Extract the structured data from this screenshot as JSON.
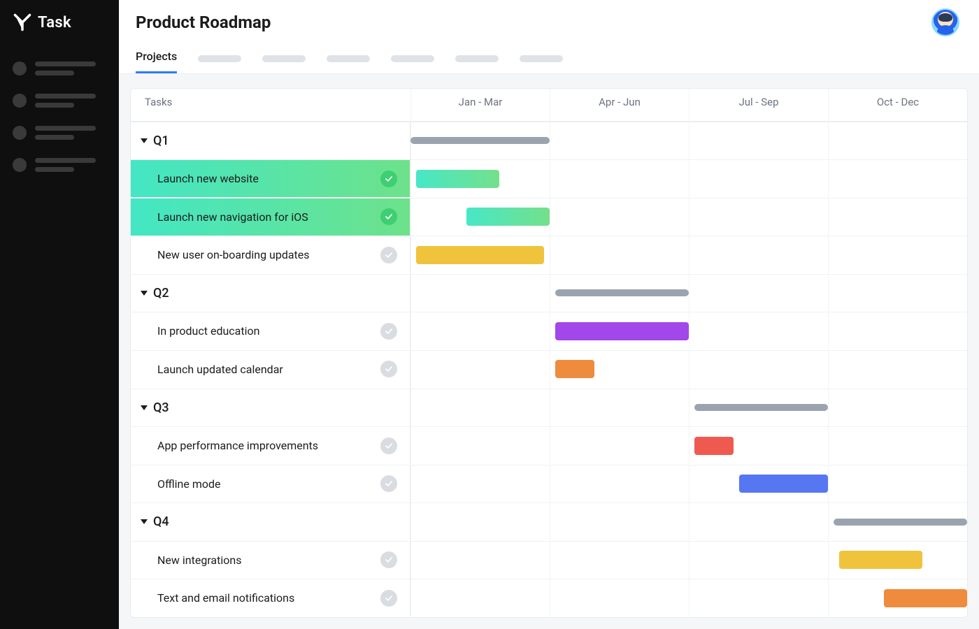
{
  "brand": {
    "name": "Task"
  },
  "header": {
    "title": "Product Roadmap"
  },
  "tabs": {
    "active": "Projects",
    "placeholder_count": 6
  },
  "chart_data": {
    "type": "gantt",
    "columns_header": "Tasks",
    "periods": [
      "Jan - Mar",
      "Apr - Jun",
      "Jul - Sep",
      "Oct - Dec"
    ],
    "groups": [
      {
        "name": "Q1",
        "summary": {
          "start": 0.0,
          "end": 0.25
        },
        "tasks": [
          {
            "name": "Launch new website",
            "done": true,
            "selected": true,
            "color": "green",
            "start": 0.01,
            "end": 0.16
          },
          {
            "name": "Launch new navigation for iOS",
            "done": true,
            "selected": true,
            "color": "green",
            "start": 0.1,
            "end": 0.25
          },
          {
            "name": "New user on-boarding updates",
            "done": false,
            "color": "yellow",
            "start": 0.01,
            "end": 0.24
          }
        ]
      },
      {
        "name": "Q2",
        "summary": {
          "start": 0.26,
          "end": 0.5
        },
        "tasks": [
          {
            "name": "In product education",
            "done": false,
            "color": "purple",
            "start": 0.26,
            "end": 0.5
          },
          {
            "name": "Launch updated calendar",
            "done": false,
            "color": "orange",
            "start": 0.26,
            "end": 0.33
          }
        ]
      },
      {
        "name": "Q3",
        "summary": {
          "start": 0.51,
          "end": 0.75
        },
        "tasks": [
          {
            "name": "App performance improvements",
            "done": false,
            "color": "red",
            "start": 0.51,
            "end": 0.58
          },
          {
            "name": "Offline mode",
            "done": false,
            "color": "blue",
            "start": 0.59,
            "end": 0.75
          }
        ]
      },
      {
        "name": "Q4",
        "summary": {
          "start": 0.76,
          "end": 1.0
        },
        "tasks": [
          {
            "name": "New integrations",
            "done": false,
            "color": "yellow",
            "start": 0.77,
            "end": 0.92
          },
          {
            "name": "Text  and email notifications",
            "done": false,
            "color": "orange",
            "start": 0.85,
            "end": 1.0
          }
        ]
      }
    ]
  }
}
